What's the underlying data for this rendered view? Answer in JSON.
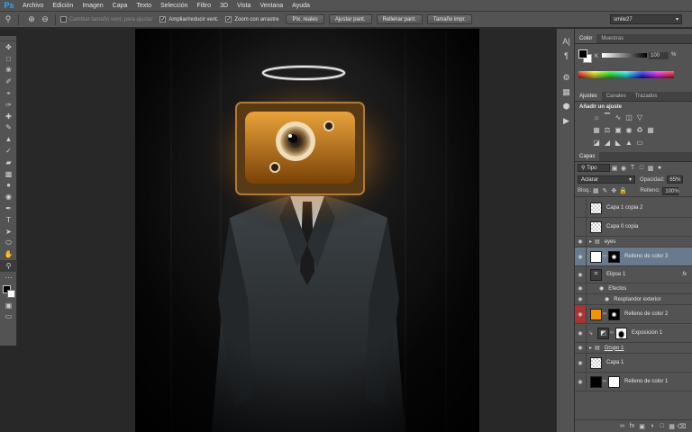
{
  "menubar": {
    "logo": "Ps",
    "items": [
      "Archivo",
      "Edición",
      "Imagen",
      "Capa",
      "Texto",
      "Selección",
      "Filtro",
      "3D",
      "Vista",
      "Ventana",
      "Ayuda"
    ]
  },
  "options": {
    "checkboxes": [
      {
        "label": "Cambiar tamaño vent. para ajustar",
        "checked": false,
        "dim": true
      },
      {
        "label": "Ampliar/reducir vent.",
        "checked": true,
        "dim": false
      },
      {
        "label": "Zoom con arrastre",
        "checked": true,
        "dim": false
      }
    ],
    "buttons": [
      "Píx. reales",
      "Ajustar pant.",
      "Rellenar pant.",
      "Tamaño impr."
    ],
    "workspace": "smile27"
  },
  "color_panel": {
    "tabs": [
      "Color",
      "Muestras"
    ],
    "k_label": "K",
    "k_value": "100",
    "k_unit": "%"
  },
  "adjustments_panel": {
    "tabs": [
      "Ajustes",
      "Canales",
      "Trazados"
    ],
    "title": "Añadir un ajuste"
  },
  "layers_panel": {
    "tab": "Capas",
    "filter": "Tipo",
    "blend_mode": "Aclarar",
    "opacity_label": "Opacidad:",
    "opacity": "65%",
    "lock_label": "Bloq.:",
    "fill_label": "Relleno:",
    "fill": "100%",
    "layers": [
      {
        "name": "Capa 1 copia 2",
        "thumb": "check",
        "visible": false,
        "height": 21
      },
      {
        "name": "Capa 0 copia",
        "thumb": "check",
        "visible": false,
        "height": 21
      },
      {
        "name": "eyes",
        "thumb": "folder",
        "visible": true,
        "height": 12
      },
      {
        "name": "Relleno de color 3",
        "thumb": "white",
        "mask": "mask-dark",
        "visible": true,
        "selected": true,
        "height": 21
      },
      {
        "name": "Elipse 1",
        "thumb": "adj",
        "visible": true,
        "fx": true,
        "height": 19
      },
      {
        "name": "Efectos",
        "sub": true,
        "visible": true,
        "height": 12
      },
      {
        "name": "Resplandor exterior",
        "sub": true,
        "visible": true,
        "height": 12
      },
      {
        "name": "Relleno de color 2",
        "thumb": "orange",
        "mask": "mask-dark",
        "visible": true,
        "red": true,
        "height": 21
      },
      {
        "name": "Exposición 1",
        "thumb": "adj",
        "mask": "mask-person",
        "visible": true,
        "clip": true,
        "height": 21
      },
      {
        "name": "Grupo 1",
        "thumb": "folder",
        "visible": true,
        "height": 12
      },
      {
        "name": "Capa 1",
        "thumb": "check",
        "visible": true,
        "height": 21
      },
      {
        "name": "Relleno de color 1",
        "thumb": "black",
        "mask": "white",
        "visible": true,
        "height": 21
      }
    ]
  }
}
